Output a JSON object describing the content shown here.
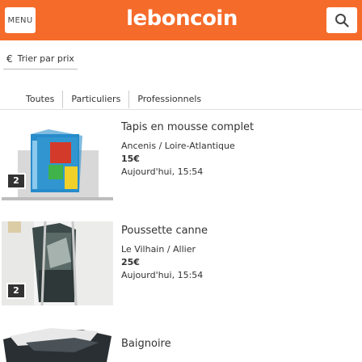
{
  "header": {
    "menu_label": "MENU",
    "logo": "leboncoin"
  },
  "sort": {
    "icon_glyph": "€",
    "label": "Trier par prix"
  },
  "tabs": [
    {
      "label": "Toutes"
    },
    {
      "label": "Particuliers"
    },
    {
      "label": "Professionnels"
    }
  ],
  "listings": [
    {
      "title": "Tapis en mousse complet",
      "location": "Ancenis / Loire-Atlantique",
      "price": "15€",
      "date": "Aujourd'hui, 15:54",
      "photo_count": "2"
    },
    {
      "title": "Poussette canne",
      "location": "Le Vilhain / Allier",
      "price": "25€",
      "date": "Aujourd'hui, 15:54",
      "photo_count": "2"
    },
    {
      "title": "Baignoire"
    }
  ],
  "colors": {
    "brand": "#f56b2a",
    "text": "#333333"
  }
}
